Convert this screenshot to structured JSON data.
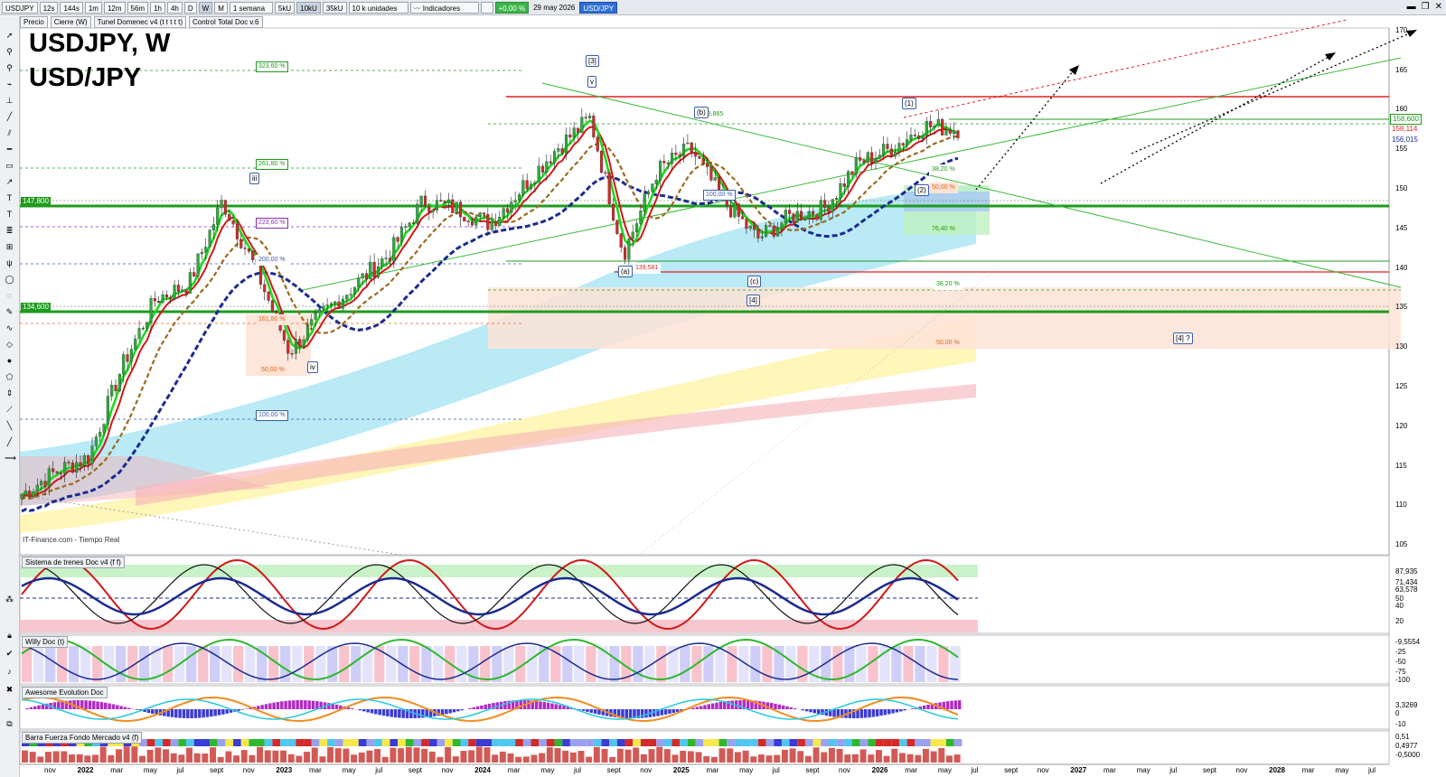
{
  "toolbar": {
    "symbol": "USDJPY",
    "intervals": [
      "12s",
      "144s",
      "1m",
      "12m",
      "56m",
      "1h",
      "4h",
      "D",
      "W",
      "M"
    ],
    "period": "1 semana",
    "volumes": [
      "5kU",
      "10kU",
      "35kU"
    ],
    "units": "10 k unidades",
    "indicators": "Indicadores",
    "change": "+0,00 %",
    "date": "29 may 2026",
    "pair_tag": "USD/JPY"
  },
  "legend": {
    "price": "Precio",
    "close": "Cierre (W)",
    "tunnel": "Tunel Domenec v4 (t t t t t)",
    "control": "Control Total Doc v.6"
  },
  "title": {
    "line1": "USDJPY, W",
    "line2": "USD/JPY"
  },
  "credit": "IT-Finance.com - Tiempo Real",
  "panels": {
    "p1": "Sistema de trenes Doc v4 (f f)",
    "p2": "Willy Doc (t)",
    "p3": "Awesome Evolution Doc",
    "p4": "Barra Fuerza Fondo Mercado v4 (f)"
  },
  "price_axis": [
    "170",
    "165",
    "160",
    "155",
    "150",
    "145",
    "140",
    "135",
    "130",
    "125",
    "120",
    "115",
    "110",
    "105"
  ],
  "price_tags": {
    "current": "158,600",
    "red": "158,114",
    "blue": "156,015"
  },
  "left_levels": {
    "upper": "147,800",
    "lower": "134,600"
  },
  "fib_levels": [
    "323,60 %",
    "261,80 %",
    "223,60 %",
    "200,00 %",
    "161,80 %",
    "50,00 %",
    "100,00 %",
    "100,00 %",
    "38,20 %",
    "50,00 %",
    "76,40 %",
    "38,20 %",
    "50,00 %"
  ],
  "price_labels": {
    "high_b": "153,865",
    "low_a": "139,581"
  },
  "waves": [
    "[3]",
    "v",
    "iii",
    "iv",
    "(b)",
    "(a)",
    "(c)",
    "[4]",
    "(1)",
    "(2)",
    "[4] ?"
  ],
  "panel_axis": {
    "p1": [
      "87,935",
      "71,434",
      "63,578",
      "50",
      "40",
      "20"
    ],
    "p2": [
      "-9,5554",
      "-25",
      "-50",
      "-75",
      "-100"
    ],
    "p3": [
      "3,3269",
      "0",
      "-10"
    ],
    "p4": [
      "0,51",
      "0,4977",
      "-0,5000"
    ]
  },
  "time_axis": [
    "nov",
    "2022",
    "mar",
    "may",
    "jul",
    "sept",
    "nov",
    "2023",
    "mar",
    "may",
    "jul",
    "sept",
    "nov",
    "2024",
    "mar",
    "may",
    "jul",
    "sept",
    "nov",
    "2025",
    "mar",
    "may",
    "jul",
    "sept",
    "nov",
    "2026",
    "mar",
    "may",
    "jul",
    "sept",
    "nov",
    "2027",
    "mar",
    "may",
    "jul",
    "sept",
    "nov",
    "2028",
    "mar",
    "may",
    "jul"
  ],
  "colors": {
    "bull": "#2eaa3a",
    "bear": "#d42a2a",
    "ma_green": "#1ed81e",
    "ma_blue": "#1b2b8f",
    "ma_red": "#d01818",
    "ma_brown": "#9a6a1f",
    "hline_green": "#1e9b1e",
    "hline_red": "#e02020"
  },
  "chart_data": {
    "type": "line",
    "title": "USDJPY, W",
    "subtitle": "USD/JPY",
    "ylim": [
      102,
      172
    ],
    "x": [
      "2021-10",
      "2021-12",
      "2022-02",
      "2022-04",
      "2022-06",
      "2022-08",
      "2022-10",
      "2022-11",
      "2023-01",
      "2023-03",
      "2023-05",
      "2023-07",
      "2023-09",
      "2023-11",
      "2024-01",
      "2024-03",
      "2024-05",
      "2024-07",
      "2024-09",
      "2024-11",
      "2025-01",
      "2025-03",
      "2025-05",
      "2025-07",
      "2025-09",
      "2025-11",
      "2026-01",
      "2026-03",
      "2026-05"
    ],
    "series": [
      {
        "values": [
          110,
          113,
          115,
          127,
          136,
          138,
          149,
          140,
          129,
          134,
          138,
          142,
          149,
          148,
          146,
          151,
          156,
          160,
          142,
          153,
          156,
          149,
          144,
          147,
          148,
          154,
          156,
          159,
          158.6
        ]
      }
    ]
  }
}
